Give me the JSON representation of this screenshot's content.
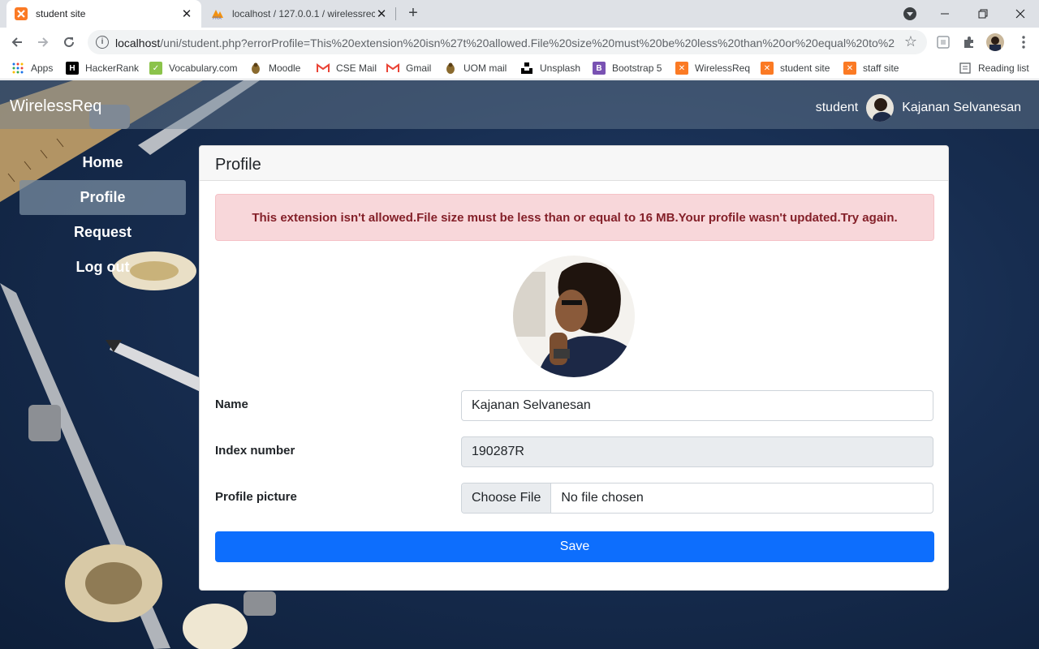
{
  "browser": {
    "tabs": [
      {
        "title": "student site",
        "active": true
      },
      {
        "title": "localhost / 127.0.0.1 / wirelessrec",
        "active": false
      }
    ],
    "url_host": "localhost",
    "url_rest": "/uni/student.php?errorProfile=This%20extension%20isn%27t%20allowed.File%20size%20must%20be%20less%20than%20or%20equal%20to%20...",
    "bookmarks": [
      "Apps",
      "HackerRank",
      "Vocabulary.com",
      "Moodle",
      "CSE Mail",
      "Gmail",
      "UOM mail",
      "Unsplash",
      "Bootstrap 5",
      "WirelessReq",
      "student site",
      "staff site"
    ],
    "reading_list": "Reading list"
  },
  "app": {
    "brand": "WirelessReq",
    "role": "student",
    "user_name": "Kajanan Selvanesan"
  },
  "sidebar": {
    "items": [
      {
        "label": "Home",
        "active": false
      },
      {
        "label": "Profile",
        "active": true
      },
      {
        "label": "Request",
        "active": false
      },
      {
        "label": "Log out",
        "active": false
      }
    ]
  },
  "profile": {
    "header": "Profile",
    "alert": "This extension isn't allowed.File size must be less than or equal to 16 MB.Your profile wasn't updated.Try again.",
    "name_label": "Name",
    "name_value": "Kajanan Selvanesan",
    "index_label": "Index number",
    "index_value": "190287R",
    "picture_label": "Profile picture",
    "choose_file": "Choose File",
    "no_file": "No file chosen",
    "save": "Save"
  },
  "colors": {
    "primary": "#0d6efd",
    "alert_bg": "#f8d7da",
    "alert_text": "#842029",
    "page_bg": "#172d50"
  }
}
